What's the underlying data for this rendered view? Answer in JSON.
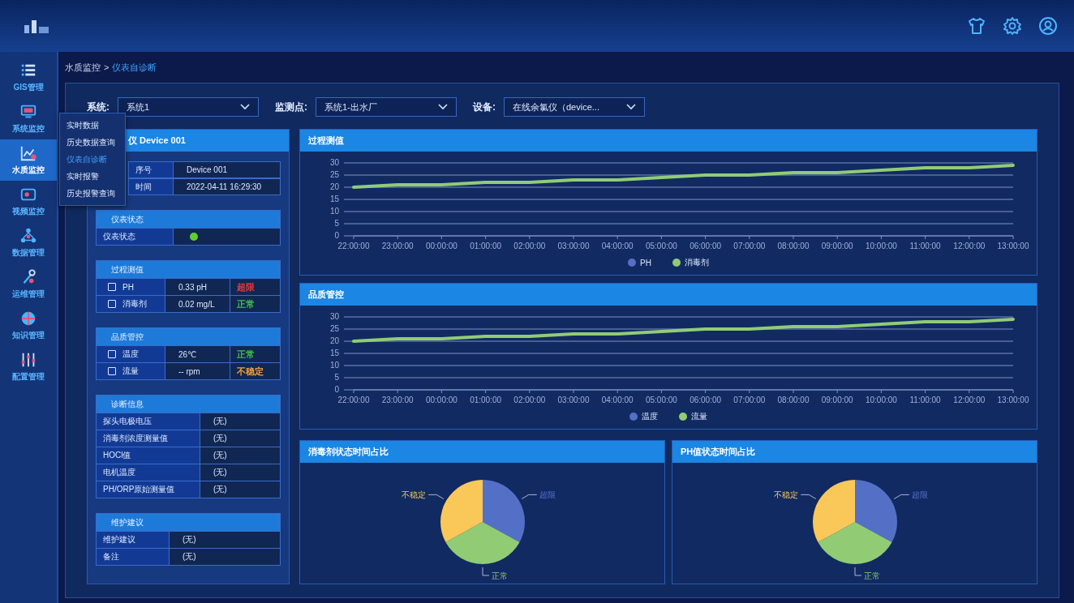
{
  "sidebar": {
    "items": [
      {
        "label": "GIS管理",
        "selected": false
      },
      {
        "label": "系统监控",
        "selected": false
      },
      {
        "label": "水质监控",
        "selected": true
      },
      {
        "label": "视频监控",
        "selected": false
      },
      {
        "label": "数据管理",
        "selected": false
      },
      {
        "label": "运维管理",
        "selected": false
      },
      {
        "label": "知识管理",
        "selected": false
      },
      {
        "label": "配置管理",
        "selected": false
      }
    ]
  },
  "breadcrumb": {
    "parent": "水质监控",
    "separator": ">",
    "current": "仪表自诊断"
  },
  "submenu": {
    "items": [
      {
        "label": "实时数据",
        "selected": false
      },
      {
        "label": "历史数据查询",
        "selected": false
      },
      {
        "label": "仪表自诊断",
        "selected": true
      },
      {
        "label": "实时报警",
        "selected": false
      },
      {
        "label": "历史报警查询",
        "selected": false
      }
    ]
  },
  "filters": [
    {
      "label": "系统:",
      "value": "系统1"
    },
    {
      "label": "监测点:",
      "value": "系统1-出水厂"
    },
    {
      "label": "设备:",
      "value": "在线余氯仪（device..."
    }
  ],
  "device_panel": {
    "title": "仪 Device 001",
    "info_rows": [
      {
        "label": "序号",
        "value": "Device 001"
      },
      {
        "label": "时间",
        "value": "2022-04-11 16:29:30"
      }
    ],
    "sections": [
      {
        "title": "仪表状态",
        "kind": "status",
        "rows": [
          {
            "label": "仪表状态",
            "color": "#5fd12e"
          }
        ]
      },
      {
        "title": "过程测值",
        "kind": "check",
        "rows": [
          {
            "label": "PH",
            "checked": false,
            "value": "0.33 pH",
            "state": "超限",
            "color": "#e5383b"
          },
          {
            "label": "消毒剂",
            "checked": false,
            "value": "0.02 mg/L",
            "state": "正常",
            "color": "#3fbf4f"
          }
        ]
      },
      {
        "title": "品质管控",
        "kind": "check",
        "rows": [
          {
            "label": "温度",
            "checked": false,
            "value": "26℃",
            "state": "正常",
            "color": "#3fbf4f"
          },
          {
            "label": "流量",
            "checked": false,
            "value": "-- rpm",
            "state": "不稳定",
            "color": "#f0a23a"
          }
        ]
      },
      {
        "title": "诊断信息",
        "kind": "pair",
        "rows": [
          {
            "label": "探头电极电压",
            "value": "(无)"
          },
          {
            "label": "消毒剂浓度测量值",
            "value": "(无)"
          },
          {
            "label": "HOCl值",
            "value": "(无)"
          },
          {
            "label": "电机温度",
            "value": "(无)"
          },
          {
            "label": "PH/ORP原始测量值",
            "value": "(无)"
          }
        ]
      },
      {
        "title": "维护建议",
        "kind": "pair",
        "rows": [
          {
            "label": "维护建议",
            "value": "(无)"
          },
          {
            "label": "备注",
            "value": "(无)"
          }
        ]
      }
    ]
  },
  "line_charts": [
    {
      "title": "过程测值",
      "chart_data": {
        "type": "line",
        "grid": true,
        "categories": [
          "22:00:00",
          "23:00:00",
          "00:00:00",
          "01:00:00",
          "02:00:00",
          "03:00:00",
          "04:00:00",
          "05:00:00",
          "06:00:00",
          "07:00:00",
          "08:00:00",
          "09:00:00",
          "10:00:00",
          "11:00:00",
          "12:00:00",
          "13:00:00"
        ],
        "ylim": [
          0,
          30
        ],
        "yticks": [
          0,
          5,
          10,
          15,
          20,
          25,
          30
        ],
        "series": [
          {
            "name": "PH",
            "color": "#5470c6",
            "values": [
              null,
              null,
              null,
              null,
              null,
              null,
              null,
              null,
              null,
              null,
              null,
              null,
              null,
              null,
              null,
              null
            ]
          },
          {
            "name": "消毒剂",
            "color": "#91cc75",
            "values": [
              20,
              21,
              21,
              22,
              22,
              23,
              23,
              24,
              25,
              25,
              26,
              26,
              27,
              28,
              28,
              29
            ]
          }
        ]
      }
    },
    {
      "title": "品质管控",
      "chart_data": {
        "type": "line",
        "grid": true,
        "categories": [
          "22:00:00",
          "23:00:00",
          "00:00:00",
          "01:00:00",
          "02:00:00",
          "03:00:00",
          "04:00:00",
          "05:00:00",
          "06:00:00",
          "07:00:00",
          "08:00:00",
          "09:00:00",
          "10:00:00",
          "11:00:00",
          "12:00:00",
          "13:00:00"
        ],
        "ylim": [
          0,
          30
        ],
        "yticks": [
          0,
          5,
          10,
          15,
          20,
          25,
          30
        ],
        "series": [
          {
            "name": "温度",
            "color": "#5470c6",
            "values": [
              null,
              null,
              null,
              null,
              null,
              null,
              null,
              null,
              null,
              null,
              null,
              null,
              null,
              null,
              null,
              null
            ]
          },
          {
            "name": "流量",
            "color": "#91cc75",
            "values": [
              20,
              21,
              21,
              22,
              22,
              23,
              23,
              24,
              25,
              25,
              26,
              26,
              27,
              28,
              28,
              29
            ]
          }
        ]
      }
    }
  ],
  "pie_charts": [
    {
      "title": "消毒剂状态时间占比",
      "chart_data": {
        "type": "pie",
        "categories": [
          "超限",
          "正常",
          "不稳定"
        ],
        "values": [
          33,
          34,
          33
        ],
        "colors": [
          "#5470c6",
          "#91cc75",
          "#fac858"
        ]
      }
    },
    {
      "title": "PH值状态时间占比",
      "chart_data": {
        "type": "pie",
        "categories": [
          "超限",
          "正常",
          "不稳定"
        ],
        "values": [
          33,
          34,
          33
        ],
        "colors": [
          "#5470c6",
          "#91cc75",
          "#fac858"
        ]
      }
    }
  ]
}
